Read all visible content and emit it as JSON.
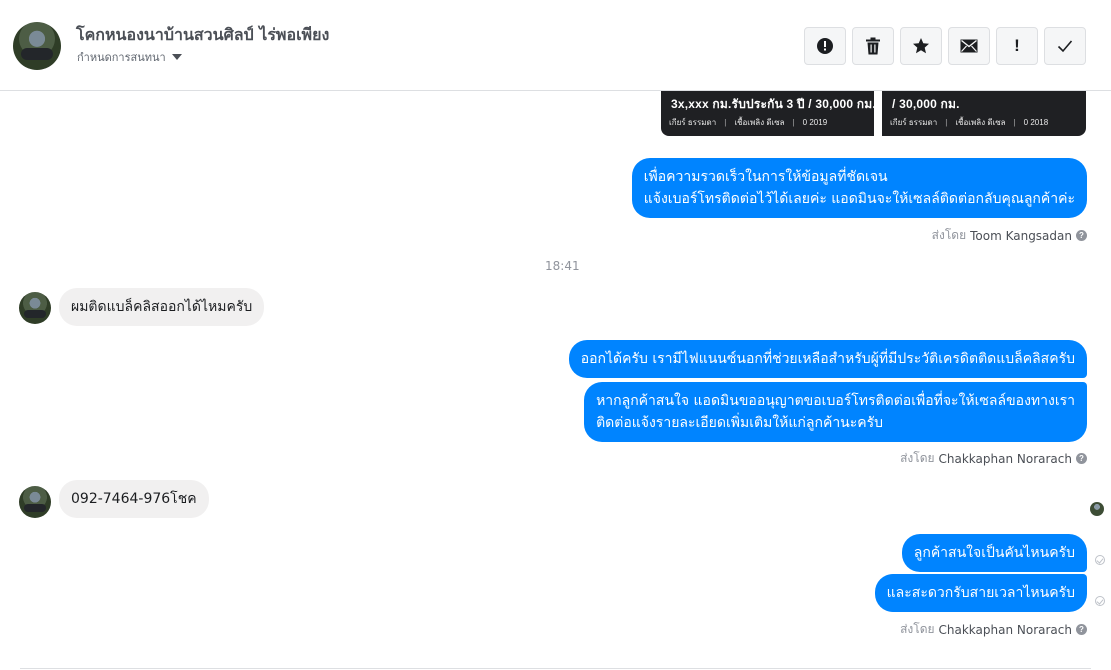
{
  "header": {
    "title": "โคกหนองนาบ้านสวนศิลป์ ไร่พอเพียง",
    "subtitle": "กำหนดการสนทนา",
    "actions": [
      {
        "icon": "alert-circle-icon"
      },
      {
        "icon": "trash-icon"
      },
      {
        "icon": "star-icon"
      },
      {
        "icon": "envelope-icon"
      },
      {
        "icon": "exclamation-icon",
        "label": "!"
      },
      {
        "icon": "checkmark-icon"
      }
    ]
  },
  "cards": [
    {
      "text": "3x,xxx กม.รับประกัน 3 ปี / 30,000 กม.",
      "gear": "เกียร์ ธรรมดา",
      "fuel": "เชื้อเพลิง ดีเซล",
      "year": "0 2019"
    },
    {
      "text": "/ 30,000 กม.",
      "gear": "เกียร์ ธรรมดา",
      "fuel": "เชื้อเพลิง ดีเซล",
      "year": "0 2018"
    }
  ],
  "messages": {
    "m1_line1": "เพื่อความรวดเร็วในการให้ข้อมูลที่ชัดเจน",
    "m1_line2": "แจ้งเบอร์โทรติดต่อไว้ได้เลยค่ะ แอดมินจะให้เซลล์ติดต่อกลับคุณลูกค้าค่ะ",
    "sent_by_label": "ส่งโดย",
    "sent_by_1": "Toom Kangsadan",
    "time_divider": "18:41",
    "in1": "ผมติดแบล็คลิสออกได้ไหมครับ",
    "m2": "ออกได้ครับ เรามีไฟแนนซ์นอกที่ช่วยเหลือสำหรับผู้ที่มีประวัติเครดิตติดแบล็คลิสครับ",
    "m3_line1": "หากลูกค้าสนใจ แอดมินขออนุญาตขอเบอร์โทรติดต่อเพื่อที่จะให้เซลล์ของทางเรา",
    "m3_line2": "ติดต่อแจ้งรายละเอียดเพิ่มเติมให้แก่ลูกค้านะครับ",
    "sent_by_2": "Chakkaphan Norarach",
    "in2": "092-7464-976โชค",
    "m4": "ลูกค้าสนใจเป็นคันไหนครับ",
    "m5": "และสะดวกรับสายเวลาไหนครับ",
    "sent_by_3": "Chakkaphan Norarach"
  },
  "colors": {
    "outgoing_bubble": "#0084ff",
    "incoming_bubble": "#f1f0f0",
    "meta_text": "#90949c"
  }
}
